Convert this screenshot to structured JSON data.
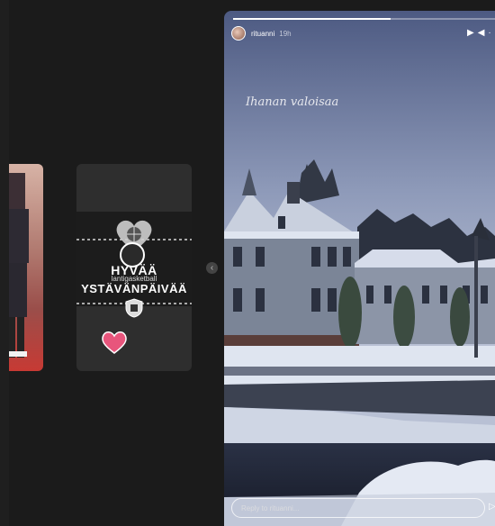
{
  "left_story": {},
  "mid_story": {
    "title_line1": "HYVÄÄ",
    "title_line2": "YSTÄVÄNPÄIVÄÄ",
    "handle": "lantigasketball"
  },
  "navigation": {
    "prev_icon": "chevron-left-icon",
    "prev_glyph": "‹"
  },
  "main_story": {
    "username": "rituanni",
    "time_ago": "19h",
    "caption": "Ihanan valoisaa",
    "progress": 0.6,
    "controls": {
      "play_glyph": "▶",
      "mute_glyph": "◀",
      "more_glyph": "·"
    },
    "reply_placeholder": "Reply to rituanni...",
    "send_glyph": "▷"
  },
  "colors": {
    "background": "#1b1b1b",
    "sky": "#8d9ab8",
    "snow": "#dfe5f0"
  }
}
